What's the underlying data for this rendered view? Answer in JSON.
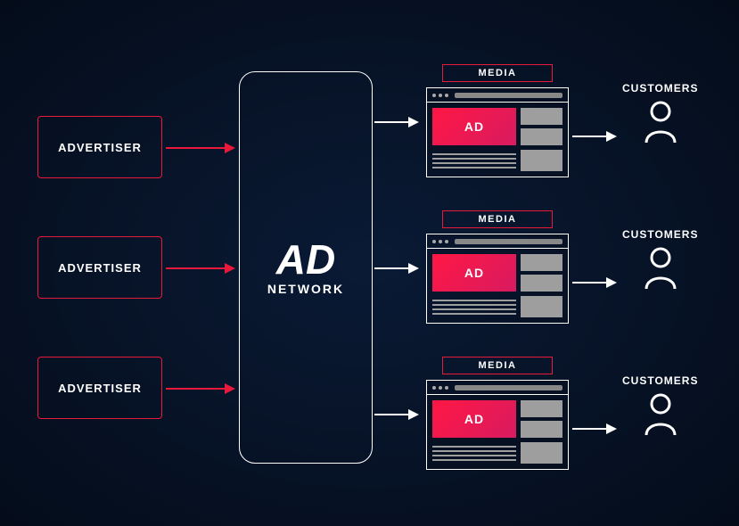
{
  "advertisers": [
    {
      "label": "ADVERTISER"
    },
    {
      "label": "ADVERTISER"
    },
    {
      "label": "ADVERTISER"
    }
  ],
  "hub": {
    "title_big": "AD",
    "title_small": "NETWORK"
  },
  "media": [
    {
      "label": "MEDIA",
      "ad_text": "AD"
    },
    {
      "label": "MEDIA",
      "ad_text": "AD"
    },
    {
      "label": "MEDIA",
      "ad_text": "AD"
    }
  ],
  "customers": [
    {
      "label": "CUSTOMERS"
    },
    {
      "label": "CUSTOMERS"
    },
    {
      "label": "CUSTOMERS"
    }
  ]
}
